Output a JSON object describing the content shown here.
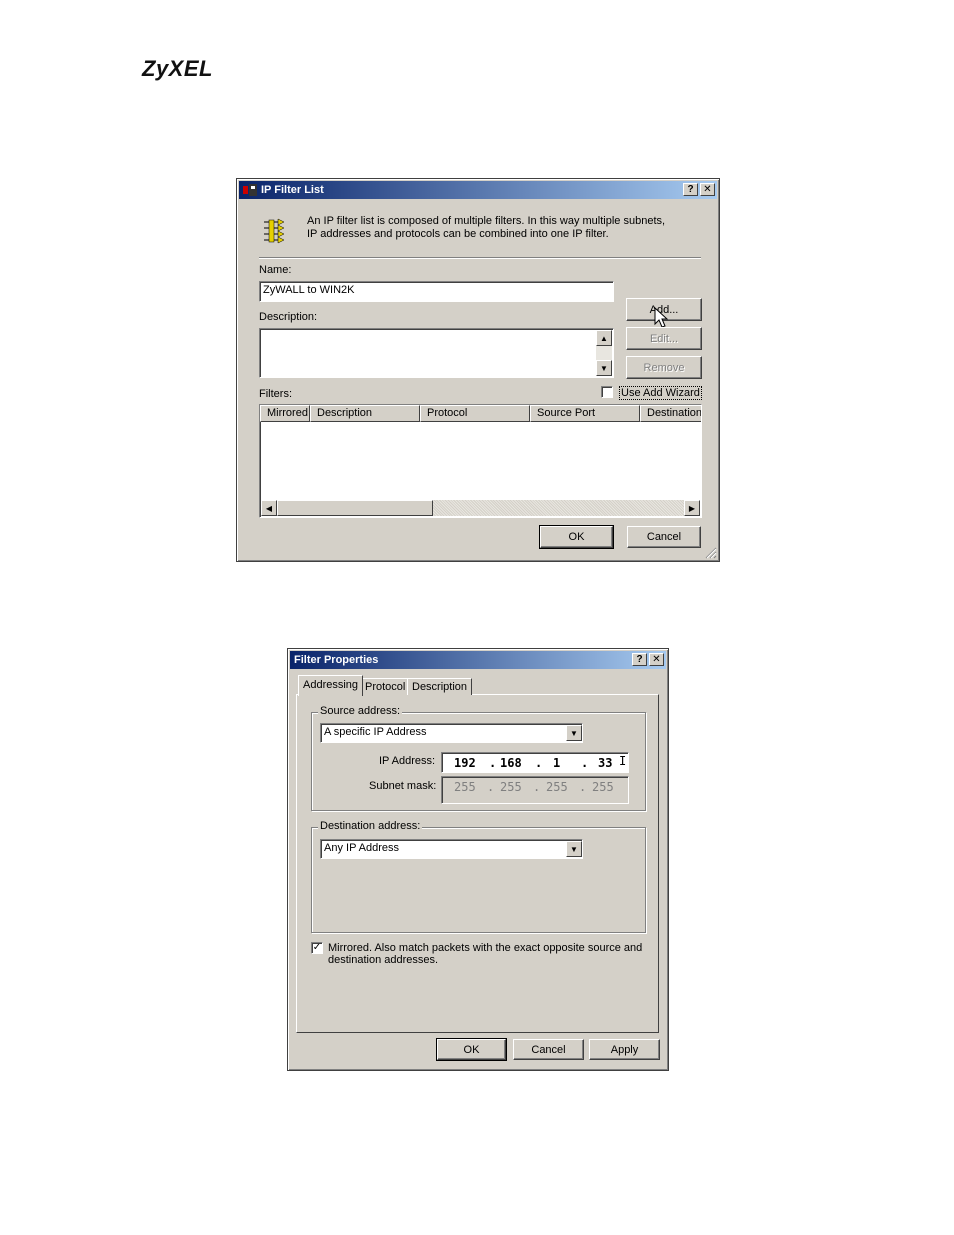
{
  "logo": "ZyXEL",
  "ip_filter_list": {
    "title": "IP Filter List",
    "intro": "An IP filter list is composed of multiple filters. In this way multiple subnets, IP addresses and protocols can be combined into one IP filter.",
    "name_label": "Name:",
    "name_value": "ZyWALL to WIN2K",
    "description_label": "Description:",
    "description_value": "",
    "filters_label": "Filters:",
    "add_button": "Add...",
    "edit_button": "Edit...",
    "remove_button": "Remove",
    "use_add_wizard": "Use Add Wizard",
    "use_add_wizard_checked": false,
    "columns": [
      "Mirrored",
      "Description",
      "Protocol",
      "Source Port",
      "Destination"
    ],
    "ok_button": "OK",
    "cancel_button": "Cancel",
    "help_button": "?",
    "close_button": "✕"
  },
  "filter_properties": {
    "title": "Filter Properties",
    "tabs": [
      "Addressing",
      "Protocol",
      "Description"
    ],
    "active_tab": "Addressing",
    "source_address_label": "Source address:",
    "source_address_value": "A specific IP Address",
    "ip_address_label": "IP Address:",
    "ip_address": [
      "192",
      "168",
      "1",
      "33"
    ],
    "subnet_mask_label": "Subnet mask:",
    "subnet_mask": [
      "255",
      "255",
      "255",
      "255"
    ],
    "destination_address_label": "Destination address:",
    "destination_address_value": "Any IP Address",
    "mirrored_checked": true,
    "mirrored_text_1": "Mirrored. Also match packets with the exact opposite source and",
    "mirrored_text_2": "destination addresses.",
    "ok_button": "OK",
    "cancel_button": "Cancel",
    "apply_button": "Apply",
    "help_button": "?",
    "close_button": "✕"
  }
}
